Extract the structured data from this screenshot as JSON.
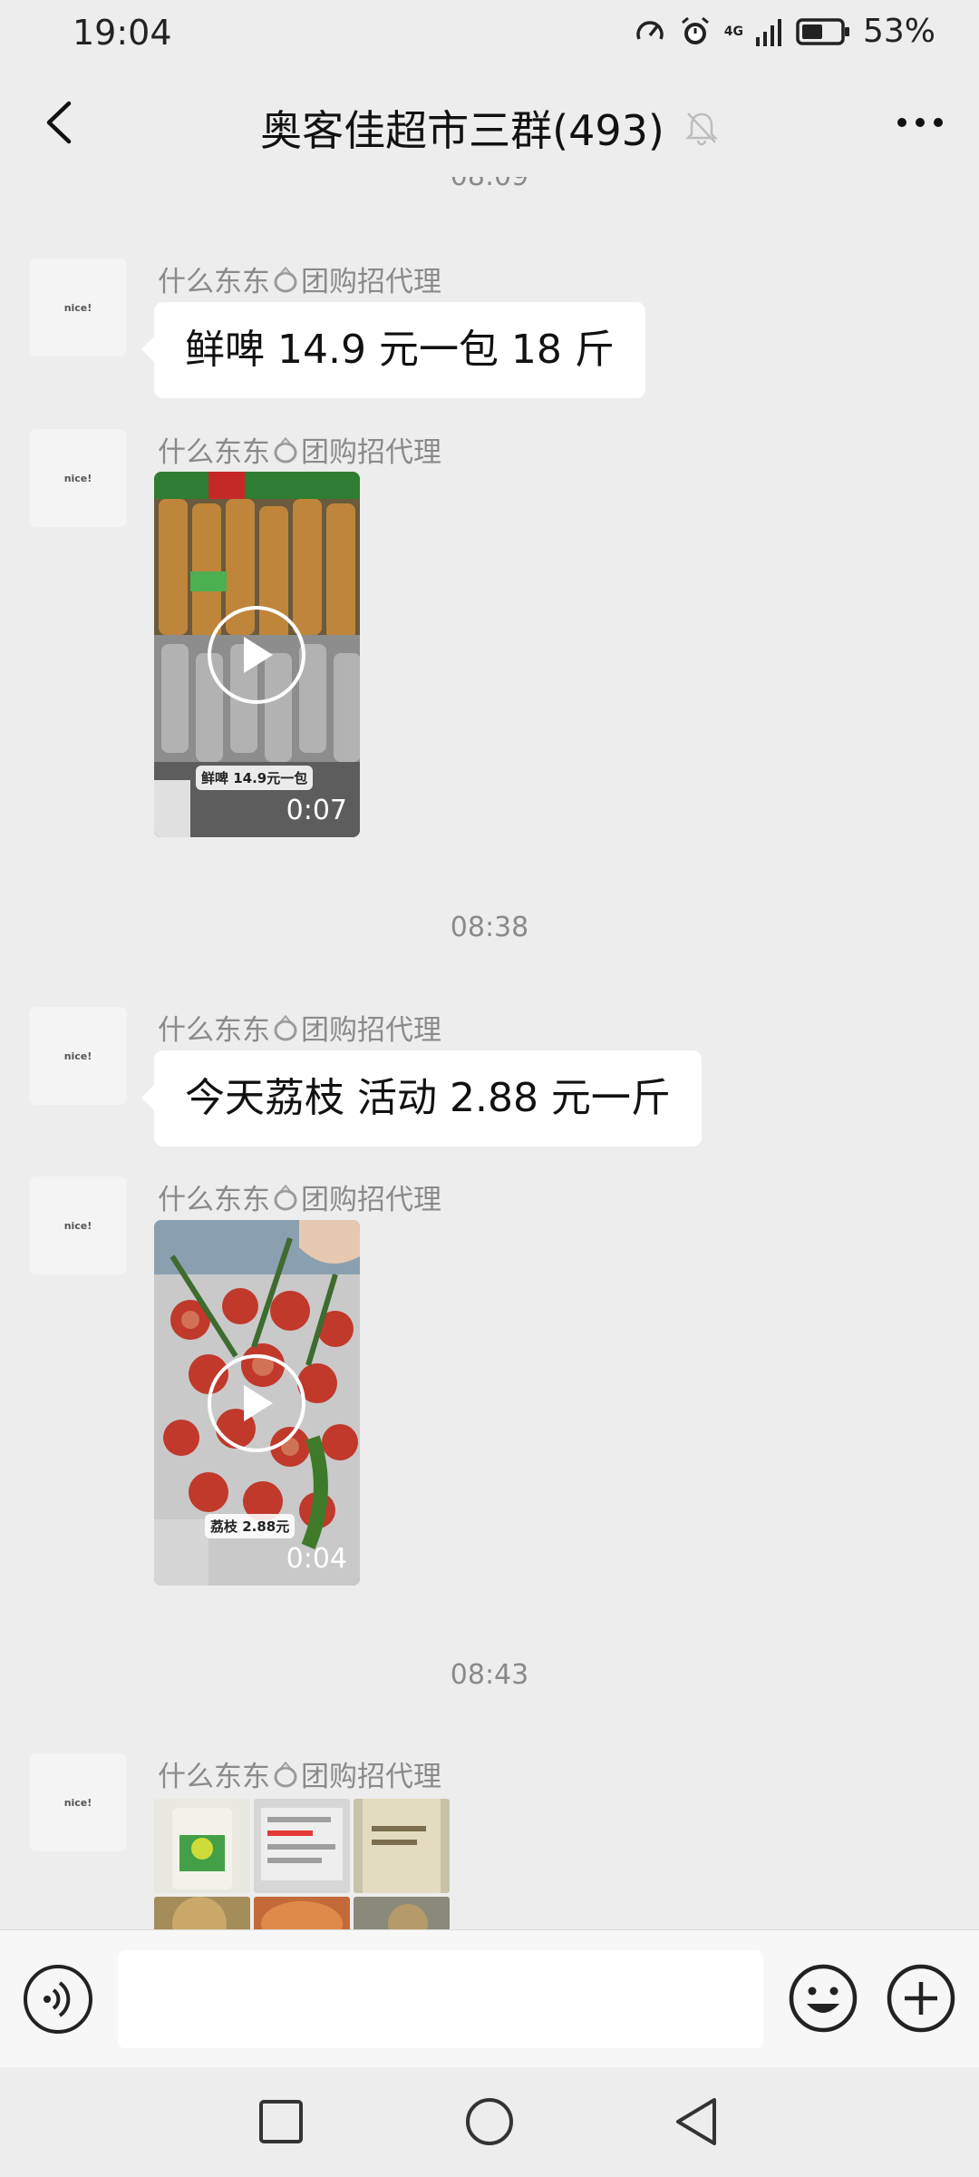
{
  "status_bar": {
    "time": "19:04",
    "network": "4G",
    "battery": "53%"
  },
  "header": {
    "title": "奥客佳超市三群(493)"
  },
  "messages": {
    "top_timestamp": "08:09",
    "sender_name": "什么东东💍团购招代理",
    "sender_prefix": "什么东东",
    "sender_suffix": "团购招代理",
    "avatar_text": "nice!",
    "m1_text": "鲜啤 14.9 元一包 18 斤",
    "m2_video_caption": "鲜啤 14.9元一包",
    "m2_video_duration": "0:07",
    "ts2": "08:38",
    "m3_text": "今天荔枝 活动 2.88 元一斤",
    "m4_video_caption": "荔枝 2.88元",
    "m4_video_duration": "0:04",
    "ts3": "08:43"
  },
  "input_bar": {
    "text_value": "",
    "placeholder": ""
  },
  "colors": {
    "background": "#ededed",
    "bubble": "#ffffff",
    "timestamp": "#8a8a8a"
  },
  "icons": {
    "back": "back-arrow-icon",
    "more": "more-dots-icon",
    "mute": "mute-bell-icon",
    "voice": "voice-icon",
    "emoji": "emoji-icon",
    "plus": "plus-icon",
    "play": "play-icon"
  }
}
